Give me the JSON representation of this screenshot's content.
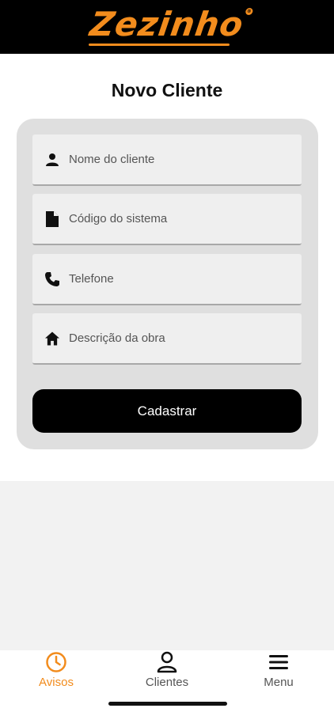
{
  "header": {
    "logo_text": "Zezinho",
    "logo_mark": "®"
  },
  "page": {
    "title": "Novo Cliente"
  },
  "form": {
    "fields": [
      {
        "icon": "person-icon",
        "placeholder": "Nome do cliente"
      },
      {
        "icon": "document-icon",
        "placeholder": "Código do sistema"
      },
      {
        "icon": "phone-icon",
        "placeholder": "Telefone"
      },
      {
        "icon": "home-icon",
        "placeholder": "Descrição da obra"
      }
    ],
    "submit_label": "Cadastrar"
  },
  "tabbar": {
    "items": [
      {
        "label": "Avisos",
        "icon": "clock-icon",
        "active": true
      },
      {
        "label": "Clientes",
        "icon": "user-icon",
        "active": false
      },
      {
        "label": "Menu",
        "icon": "hamburger-icon",
        "active": false
      }
    ]
  },
  "colors": {
    "brand": "#f28c1d",
    "header_bg": "#000000",
    "button_bg": "#000000"
  }
}
